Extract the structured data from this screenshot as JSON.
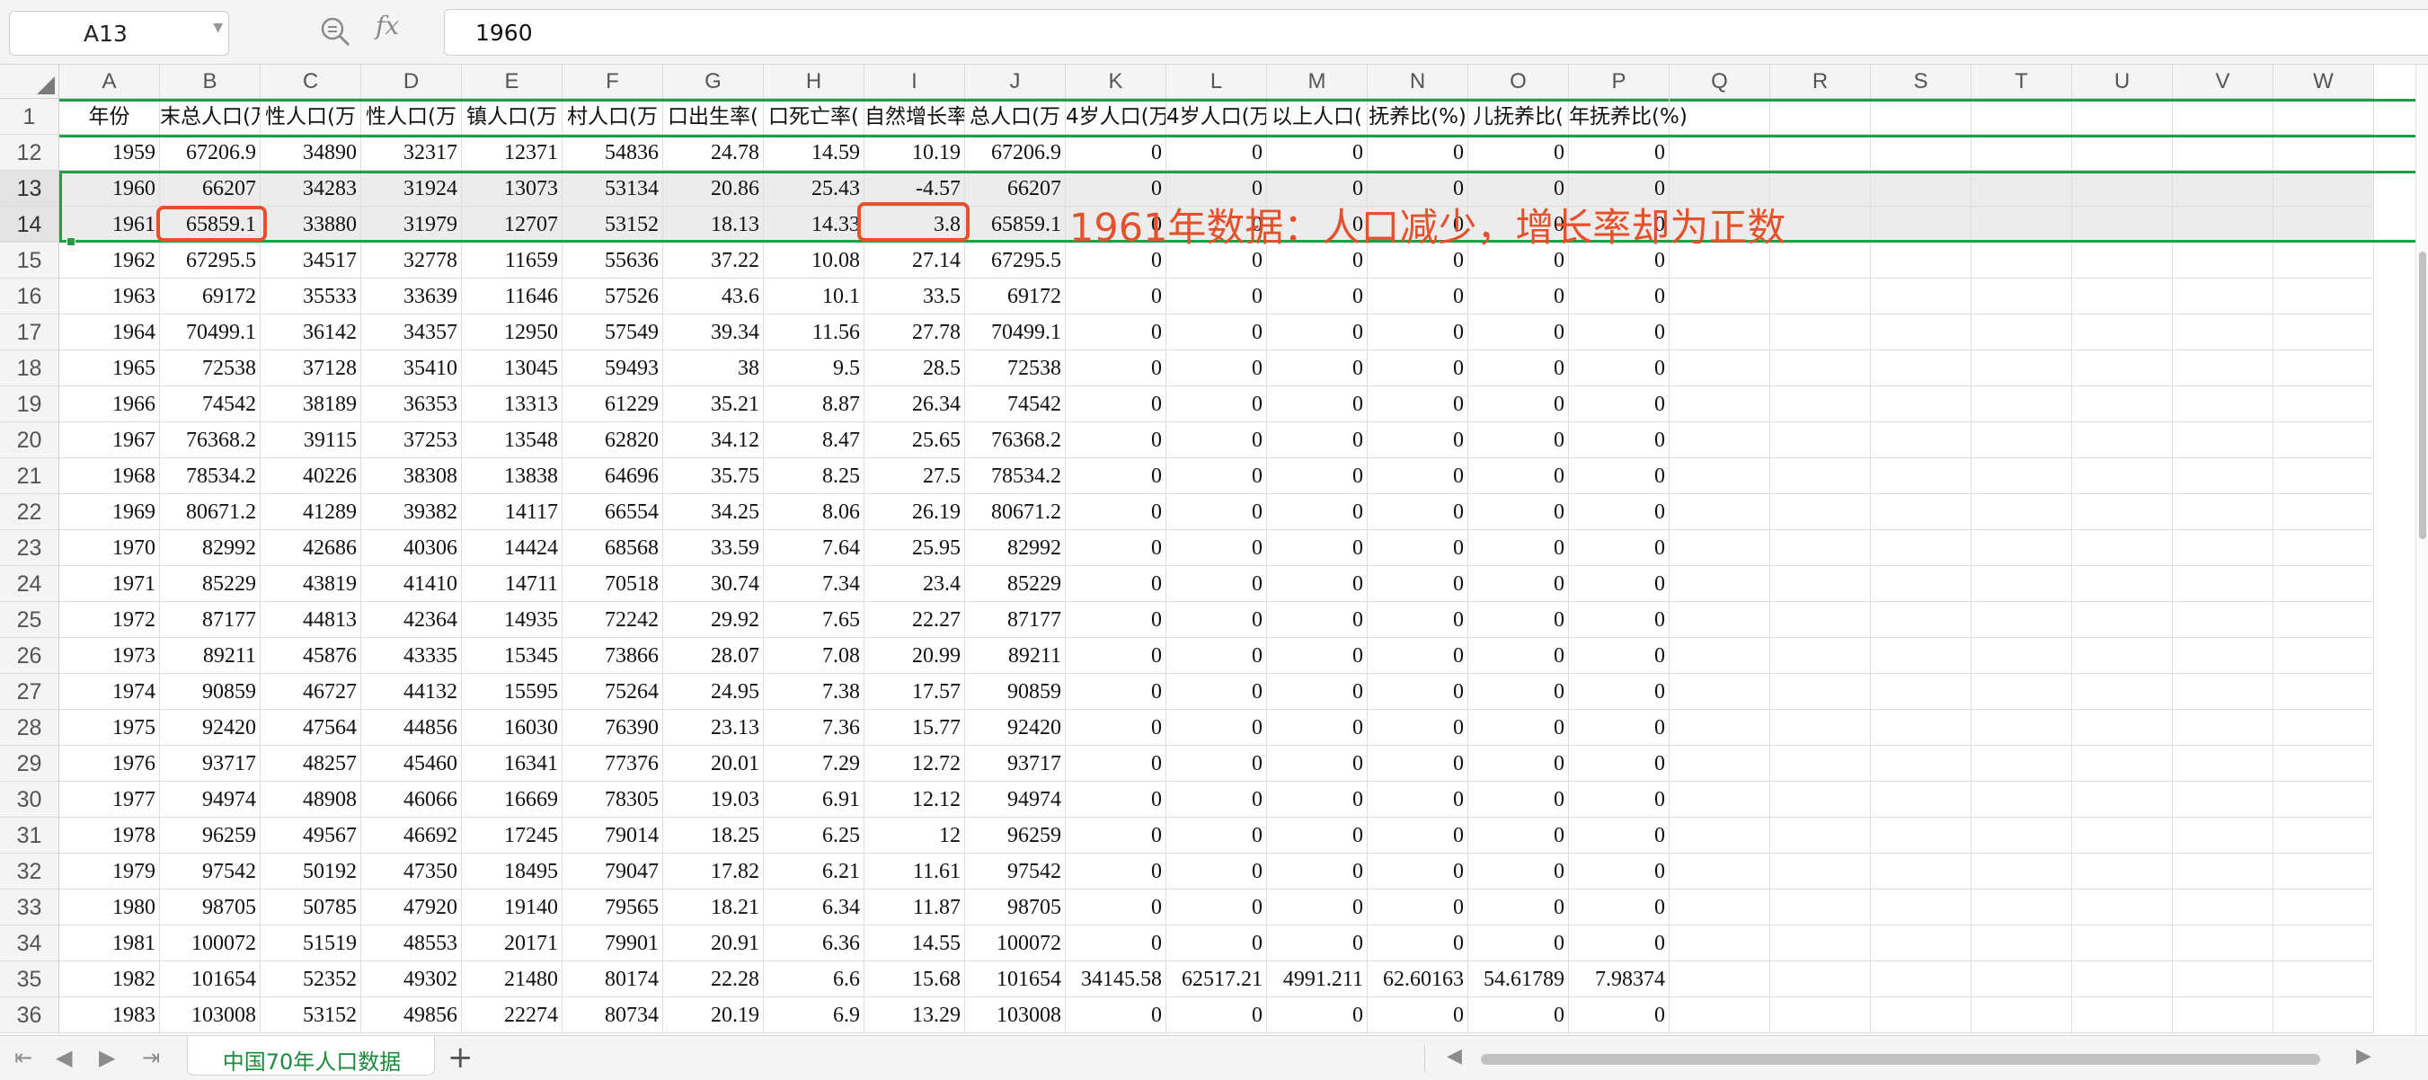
{
  "formula_bar": {
    "cell_ref": "A13",
    "formula_value": "1960"
  },
  "columns": [
    "A",
    "B",
    "C",
    "D",
    "E",
    "F",
    "G",
    "H",
    "I",
    "J",
    "K",
    "L",
    "M",
    "N",
    "O",
    "P",
    "Q",
    "R",
    "S",
    "T",
    "U",
    "V",
    "W"
  ],
  "header_row": {
    "row_number": "1",
    "labels": [
      "年份",
      "末总人口(万",
      "性人口(万",
      "性人口(万",
      "镇人口(万",
      "村人口(万",
      "口出生率(",
      "口死亡率(",
      "自然增长率",
      "总人口(万",
      "4岁人口(万",
      "4岁人口(万",
      "以上人口(",
      "抚养比(%)",
      "儿抚养比(",
      "年抚养比(%)"
    ]
  },
  "rows": [
    {
      "n": "12",
      "cells": [
        "1959",
        "67206.9",
        "34890",
        "32317",
        "12371",
        "54836",
        "24.78",
        "14.59",
        "10.19",
        "67206.9",
        "0",
        "0",
        "0",
        "0",
        "0",
        "0"
      ]
    },
    {
      "n": "13",
      "cells": [
        "1960",
        "66207",
        "34283",
        "31924",
        "13073",
        "53134",
        "20.86",
        "25.43",
        "-4.57",
        "66207",
        "0",
        "0",
        "0",
        "0",
        "0",
        "0"
      ]
    },
    {
      "n": "14",
      "cells": [
        "1961",
        "65859.1",
        "33880",
        "31979",
        "12707",
        "53152",
        "18.13",
        "14.33",
        "3.8",
        "65859.1",
        "0",
        "0",
        "0",
        "0",
        "0",
        "0"
      ]
    },
    {
      "n": "15",
      "cells": [
        "1962",
        "67295.5",
        "34517",
        "32778",
        "11659",
        "55636",
        "37.22",
        "10.08",
        "27.14",
        "67295.5",
        "0",
        "0",
        "0",
        "0",
        "0",
        "0"
      ]
    },
    {
      "n": "16",
      "cells": [
        "1963",
        "69172",
        "35533",
        "33639",
        "11646",
        "57526",
        "43.6",
        "10.1",
        "33.5",
        "69172",
        "0",
        "0",
        "0",
        "0",
        "0",
        "0"
      ]
    },
    {
      "n": "17",
      "cells": [
        "1964",
        "70499.1",
        "36142",
        "34357",
        "12950",
        "57549",
        "39.34",
        "11.56",
        "27.78",
        "70499.1",
        "0",
        "0",
        "0",
        "0",
        "0",
        "0"
      ]
    },
    {
      "n": "18",
      "cells": [
        "1965",
        "72538",
        "37128",
        "35410",
        "13045",
        "59493",
        "38",
        "9.5",
        "28.5",
        "72538",
        "0",
        "0",
        "0",
        "0",
        "0",
        "0"
      ]
    },
    {
      "n": "19",
      "cells": [
        "1966",
        "74542",
        "38189",
        "36353",
        "13313",
        "61229",
        "35.21",
        "8.87",
        "26.34",
        "74542",
        "0",
        "0",
        "0",
        "0",
        "0",
        "0"
      ]
    },
    {
      "n": "20",
      "cells": [
        "1967",
        "76368.2",
        "39115",
        "37253",
        "13548",
        "62820",
        "34.12",
        "8.47",
        "25.65",
        "76368.2",
        "0",
        "0",
        "0",
        "0",
        "0",
        "0"
      ]
    },
    {
      "n": "21",
      "cells": [
        "1968",
        "78534.2",
        "40226",
        "38308",
        "13838",
        "64696",
        "35.75",
        "8.25",
        "27.5",
        "78534.2",
        "0",
        "0",
        "0",
        "0",
        "0",
        "0"
      ]
    },
    {
      "n": "22",
      "cells": [
        "1969",
        "80671.2",
        "41289",
        "39382",
        "14117",
        "66554",
        "34.25",
        "8.06",
        "26.19",
        "80671.2",
        "0",
        "0",
        "0",
        "0",
        "0",
        "0"
      ]
    },
    {
      "n": "23",
      "cells": [
        "1970",
        "82992",
        "42686",
        "40306",
        "14424",
        "68568",
        "33.59",
        "7.64",
        "25.95",
        "82992",
        "0",
        "0",
        "0",
        "0",
        "0",
        "0"
      ]
    },
    {
      "n": "24",
      "cells": [
        "1971",
        "85229",
        "43819",
        "41410",
        "14711",
        "70518",
        "30.74",
        "7.34",
        "23.4",
        "85229",
        "0",
        "0",
        "0",
        "0",
        "0",
        "0"
      ]
    },
    {
      "n": "25",
      "cells": [
        "1972",
        "87177",
        "44813",
        "42364",
        "14935",
        "72242",
        "29.92",
        "7.65",
        "22.27",
        "87177",
        "0",
        "0",
        "0",
        "0",
        "0",
        "0"
      ]
    },
    {
      "n": "26",
      "cells": [
        "1973",
        "89211",
        "45876",
        "43335",
        "15345",
        "73866",
        "28.07",
        "7.08",
        "20.99",
        "89211",
        "0",
        "0",
        "0",
        "0",
        "0",
        "0"
      ]
    },
    {
      "n": "27",
      "cells": [
        "1974",
        "90859",
        "46727",
        "44132",
        "15595",
        "75264",
        "24.95",
        "7.38",
        "17.57",
        "90859",
        "0",
        "0",
        "0",
        "0",
        "0",
        "0"
      ]
    },
    {
      "n": "28",
      "cells": [
        "1975",
        "92420",
        "47564",
        "44856",
        "16030",
        "76390",
        "23.13",
        "7.36",
        "15.77",
        "92420",
        "0",
        "0",
        "0",
        "0",
        "0",
        "0"
      ]
    },
    {
      "n": "29",
      "cells": [
        "1976",
        "93717",
        "48257",
        "45460",
        "16341",
        "77376",
        "20.01",
        "7.29",
        "12.72",
        "93717",
        "0",
        "0",
        "0",
        "0",
        "0",
        "0"
      ]
    },
    {
      "n": "30",
      "cells": [
        "1977",
        "94974",
        "48908",
        "46066",
        "16669",
        "78305",
        "19.03",
        "6.91",
        "12.12",
        "94974",
        "0",
        "0",
        "0",
        "0",
        "0",
        "0"
      ]
    },
    {
      "n": "31",
      "cells": [
        "1978",
        "96259",
        "49567",
        "46692",
        "17245",
        "79014",
        "18.25",
        "6.25",
        "12",
        "96259",
        "0",
        "0",
        "0",
        "0",
        "0",
        "0"
      ]
    },
    {
      "n": "32",
      "cells": [
        "1979",
        "97542",
        "50192",
        "47350",
        "18495",
        "79047",
        "17.82",
        "6.21",
        "11.61",
        "97542",
        "0",
        "0",
        "0",
        "0",
        "0",
        "0"
      ]
    },
    {
      "n": "33",
      "cells": [
        "1980",
        "98705",
        "50785",
        "47920",
        "19140",
        "79565",
        "18.21",
        "6.34",
        "11.87",
        "98705",
        "0",
        "0",
        "0",
        "0",
        "0",
        "0"
      ]
    },
    {
      "n": "34",
      "cells": [
        "1981",
        "100072",
        "51519",
        "48553",
        "20171",
        "79901",
        "20.91",
        "6.36",
        "14.55",
        "100072",
        "0",
        "0",
        "0",
        "0",
        "0",
        "0"
      ]
    },
    {
      "n": "35",
      "cells": [
        "1982",
        "101654",
        "52352",
        "49302",
        "21480",
        "80174",
        "22.28",
        "6.6",
        "15.68",
        "101654",
        "34145.58",
        "62517.21",
        "4991.211",
        "62.60163",
        "54.61789",
        "7.98374"
      ]
    },
    {
      "n": "36",
      "cells": [
        "1983",
        "103008",
        "53152",
        "49856",
        "22274",
        "80734",
        "20.19",
        "6.9",
        "13.29",
        "103008",
        "0",
        "0",
        "0",
        "0",
        "0",
        "0"
      ]
    }
  ],
  "annotation": {
    "text": "1961年数据：人口减少，增长率却为正数",
    "color": "#e4512b"
  },
  "sheet_tab": {
    "label": "中国70年人口数据"
  },
  "colors": {
    "selection": "#1e9e45",
    "annotation": "#e4512b",
    "tab_text": "#1a8a3c"
  }
}
